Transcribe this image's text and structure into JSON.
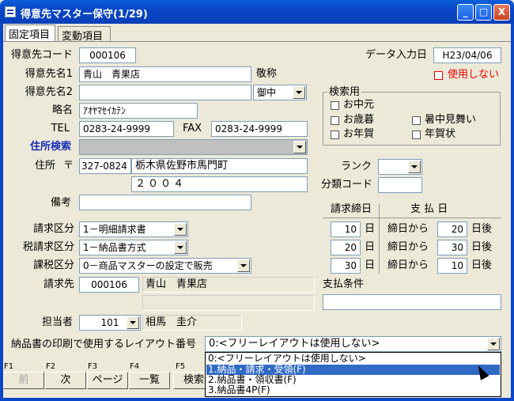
{
  "window": {
    "title": "得意先マスター保守(1/29)",
    "min_label": "_",
    "max_label": "□",
    "close_label": "X"
  },
  "tabs": [
    {
      "label": "固定項目",
      "active": true
    },
    {
      "label": "変動項目",
      "active": false
    }
  ],
  "form": {
    "customer_code_label": "得意先コード",
    "customer_code": "000106",
    "data_entry_date_label": "データ入力日",
    "data_entry_date": "H23/04/06",
    "not_in_use_label": "使用しない",
    "name1_label": "得意先名1",
    "name1": "青山　青果店",
    "honorific_label": "敬称",
    "name2_label": "得意先名2",
    "name2": "",
    "honorific_value": "御中",
    "abbr_label": "略名",
    "abbr": "ｱｵﾔﾏｾｲｶﾃﾝ",
    "tel_label": "TEL",
    "tel": "0283-24-9999",
    "fax_label": "FAX",
    "fax": "0283-24-9999",
    "address_search_label": "住所検索",
    "address_search_value": "",
    "address_label": "住所",
    "postal_mark": "〒",
    "postal_code": "327-0824",
    "address1": "栃木県佐野市馬門町",
    "address2": "２００４",
    "rank_label": "ランク",
    "rank_value": "",
    "category_code_label": "分類コード",
    "category_code": "",
    "remarks_label": "備考",
    "remarks": "",
    "billing_class_label": "請求区分",
    "billing_class": "1－明細請求書",
    "tax_class_label": "税請求区分",
    "tax_class": "1－納品書方式",
    "taxation_class_label": "課税区分",
    "taxation_class": "0－商品マスターの設定で販売",
    "bill_to_label": "請求先",
    "bill_to_code": "000106",
    "bill_to_name": "青山　青果店",
    "bill_to_name2": "",
    "staff_label": "担当者",
    "staff_code": "101",
    "staff_name": "相馬　圭介",
    "payment_terms_label": "支払条件",
    "payment_terms": ""
  },
  "search_group": {
    "title": "検索用",
    "options": [
      "お中元",
      "お歳暮",
      "暑中見舞い",
      "お年賀",
      "年賀状"
    ]
  },
  "billing_table": {
    "closing_header": "請求締日",
    "payment_header": "支 払 日",
    "day_unit": "日",
    "from_closing_label": "締日から",
    "days_after_label": "日後",
    "rows": [
      {
        "closing": "10",
        "offset": "20"
      },
      {
        "closing": "20",
        "offset": "30"
      },
      {
        "closing": "30",
        "offset": "10"
      }
    ]
  },
  "layout_select": {
    "label": "納品書の印刷で使用するレイアウト番号",
    "value": "0:<フリーレイアウトは使用しない>",
    "options": [
      "0:<フリーレイアウトは使用しない>",
      "1.納品・請求・受領(F)",
      "2.納品書・領収書(F)",
      "3.納品書4P(F)"
    ],
    "highlighted_index": 1
  },
  "fkeys": [
    {
      "key": "F1",
      "label": "前",
      "disabled": true
    },
    {
      "key": "F2",
      "label": "次",
      "disabled": false
    },
    {
      "key": "F3",
      "label": "ページ",
      "disabled": false
    },
    {
      "key": "F4",
      "label": "一覧",
      "disabled": false
    },
    {
      "key": "F5",
      "label": "検索",
      "disabled": false
    }
  ],
  "colors": {
    "titlebar": "#0a46c8",
    "highlight": "#316ac5",
    "label_blue": "#1a2fb5",
    "label_red": "#e00000"
  }
}
